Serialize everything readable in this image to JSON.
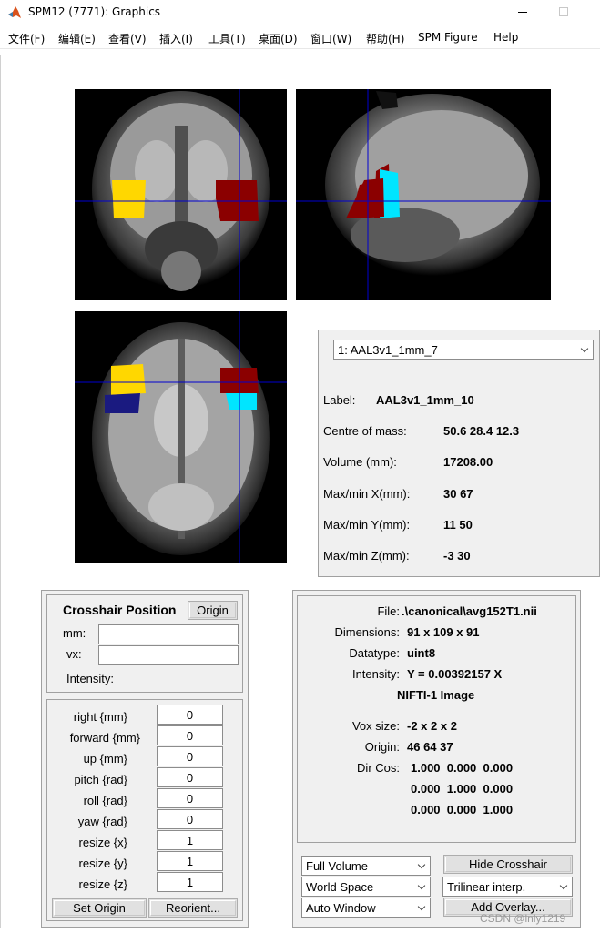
{
  "window": {
    "title": "SPM12 (7771): Graphics"
  },
  "menu": {
    "items": [
      "文件(F)",
      "编辑(E)",
      "查看(V)",
      "插入(I)",
      "工具(T)",
      "桌面(D)",
      "窗口(W)",
      "帮助(H)",
      "SPM Figure",
      "Help"
    ]
  },
  "atlas": {
    "selected": "1: AAL3v1_1mm_7",
    "label_key": "Label:",
    "label_value": "AAL3v1_1mm_10",
    "com_key": "Centre of mass:",
    "com_value": "50.6  28.4 12.3",
    "volume_key": "Volume (mm):",
    "volume_value": "17208.00",
    "maxminx_key": "Max/min X(mm):",
    "maxminx_value": "30 67",
    "maxminy_key": "Max/min Y(mm):",
    "maxminy_value": "11 50",
    "maxminz_key": "Max/min Z(mm):",
    "maxminz_value": "-3 30"
  },
  "crosshair": {
    "title": "Crosshair Position",
    "origin_button": "Origin",
    "mm_label": "mm:",
    "mm_value": "",
    "vx_label": "vx:",
    "vx_value": "",
    "intensity_label": "Intensity:"
  },
  "reorient": {
    "rows": [
      {
        "label": "right  {mm}",
        "value": "0"
      },
      {
        "label": "forward  {mm}",
        "value": "0"
      },
      {
        "label": "up  {mm}",
        "value": "0"
      },
      {
        "label": "pitch  {rad}",
        "value": "0"
      },
      {
        "label": "roll  {rad}",
        "value": "0"
      },
      {
        "label": "yaw  {rad}",
        "value": "0"
      },
      {
        "label": "resize  {x}",
        "value": "1"
      },
      {
        "label": "resize  {y}",
        "value": "1"
      },
      {
        "label": "resize  {z}",
        "value": "1"
      }
    ],
    "set_origin_button": "Set Origin",
    "reorient_button": "Reorient..."
  },
  "fileinfo": {
    "file_key": "File:",
    "file_value": ".\\canonical\\avg152T1.nii",
    "dims_key": "Dimensions:",
    "dims_value": "91 x 109 x 91",
    "dtype_key": "Datatype:",
    "dtype_value": "uint8",
    "intensity_key": "Intensity:",
    "intensity_value": "Y = 0.00392157 X",
    "format_value": "NIFTI-1 Image",
    "vox_key": "Vox size:",
    "vox_value": "-2 x 2 x 2",
    "origin_key": "Origin:",
    "origin_value": "46 64 37",
    "dircos_key": "Dir Cos:",
    "dircos_rows": [
      "1.000  0.000  0.000",
      "0.000  1.000  0.000",
      "0.000  0.000  1.000"
    ]
  },
  "controls": {
    "volume_select": "Full Volume",
    "space_select": "World Space",
    "window_select": "Auto Window",
    "hide_crosshair_button": "Hide Crosshair",
    "interp_select": "Trilinear interp.",
    "add_overlay_button": "Add Overlay..."
  },
  "watermark": "CSDN @lnly1219",
  "colors": {
    "crosshair": "#0000d0",
    "roi_dark_red": "#8b0000",
    "roi_yellow": "#ffd700",
    "roi_cyan": "#00e5ff",
    "roi_navy": "#1a1a80",
    "panel_bg": "#f0f0f0"
  }
}
